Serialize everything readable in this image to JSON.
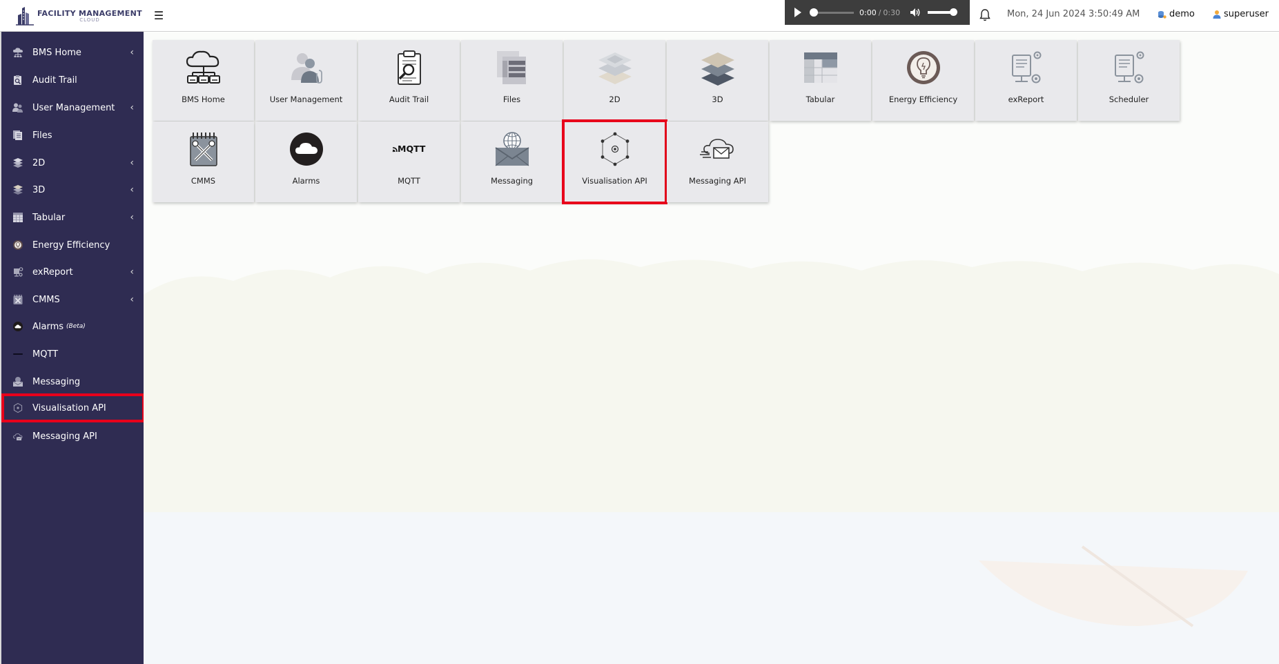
{
  "header": {
    "logo_main": "FACILITY MANAGEMENT",
    "logo_sub": "CLOUD",
    "audio": {
      "current_time": "0:00",
      "separator": "/",
      "duration": "0:30"
    },
    "datetime": "Mon, 24 Jun 2024 3:50:49 AM",
    "demo_label": "demo",
    "user_label": "superuser"
  },
  "sidebar": {
    "items": [
      {
        "label": "BMS Home",
        "has_chevron": true
      },
      {
        "label": "Audit Trail",
        "has_chevron": false
      },
      {
        "label": "User Management",
        "has_chevron": true
      },
      {
        "label": "Files",
        "has_chevron": false
      },
      {
        "label": "2D",
        "has_chevron": true
      },
      {
        "label": "3D",
        "has_chevron": true
      },
      {
        "label": "Tabular",
        "has_chevron": true
      },
      {
        "label": "Energy Efficiency",
        "has_chevron": false
      },
      {
        "label": "exReport",
        "has_chevron": true
      },
      {
        "label": "CMMS",
        "has_chevron": true
      },
      {
        "label": "Alarms",
        "badge": "(Beta)",
        "has_chevron": false
      },
      {
        "label": "MQTT",
        "has_chevron": false
      },
      {
        "label": "Messaging",
        "has_chevron": false
      },
      {
        "label": "Visualisation API",
        "has_chevron": false,
        "highlighted": true
      },
      {
        "label": "Messaging API",
        "has_chevron": false
      }
    ],
    "chevron": "‹"
  },
  "tiles": [
    {
      "label": "BMS Home",
      "icon": "cloud-network-icon"
    },
    {
      "label": "User Management",
      "icon": "users-icon"
    },
    {
      "label": "Audit Trail",
      "icon": "clipboard-search-icon"
    },
    {
      "label": "Files",
      "icon": "files-icon"
    },
    {
      "label": "2D",
      "icon": "layers-2d-icon"
    },
    {
      "label": "3D",
      "icon": "layers-3d-icon"
    },
    {
      "label": "Tabular",
      "icon": "table-icon"
    },
    {
      "label": "Energy Efficiency",
      "icon": "lightbulb-icon"
    },
    {
      "label": "exReport",
      "icon": "report-gear-icon"
    },
    {
      "label": "Scheduler",
      "icon": "scheduler-gear-icon"
    },
    {
      "label": "CMMS",
      "icon": "tools-icon"
    },
    {
      "label": "Alarms",
      "icon": "cloud-circle-icon"
    },
    {
      "label": "MQTT",
      "icon": "mqtt-logo-icon",
      "icon_text": "MQTT"
    },
    {
      "label": "Messaging",
      "icon": "envelope-globe-icon"
    },
    {
      "label": "Visualisation API",
      "icon": "hexagon-network-icon",
      "highlighted": true
    },
    {
      "label": "Messaging API",
      "icon": "cloud-envelope-icon"
    }
  ],
  "colors": {
    "sidebar_bg": "#2f2c52",
    "highlight": "#e8001b",
    "tile_bg": "#e9e9ec",
    "audio_bg": "#3d3d3d"
  }
}
